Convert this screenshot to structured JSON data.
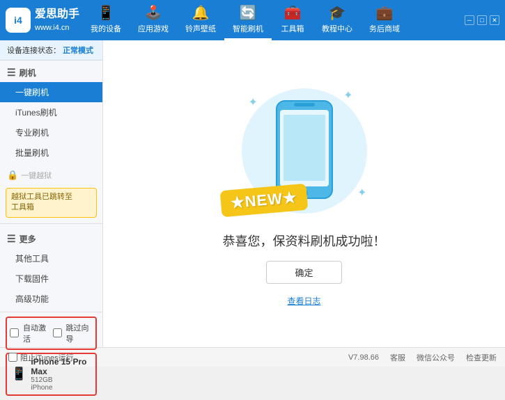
{
  "app": {
    "logo_code": "i4",
    "logo_url": "www.i4.cn",
    "title": "爱思助手"
  },
  "nav": {
    "items": [
      {
        "id": "my-device",
        "label": "我的设备",
        "icon": "📱",
        "active": false
      },
      {
        "id": "apps-games",
        "label": "应用游戏",
        "icon": "👤",
        "active": false
      },
      {
        "id": "ringtone",
        "label": "铃声壁纸",
        "icon": "🔔",
        "active": false
      },
      {
        "id": "smart-flash",
        "label": "智能刷机",
        "icon": "🔄",
        "active": true
      },
      {
        "id": "toolbox",
        "label": "工具箱",
        "icon": "🧰",
        "active": false
      },
      {
        "id": "tutorials",
        "label": "教程中心",
        "icon": "🎓",
        "active": false
      },
      {
        "id": "service",
        "label": "务后商域",
        "icon": "💼",
        "active": false
      }
    ]
  },
  "sidebar": {
    "status_label": "设备连接状态：",
    "status_value": "正常模式",
    "section_flash": "刷机",
    "items": [
      {
        "id": "one-key-flash",
        "label": "一键刷机",
        "active": true
      },
      {
        "id": "itunes-flash",
        "label": "iTunes刷机",
        "active": false
      },
      {
        "id": "pro-flash",
        "label": "专业刷机",
        "active": false
      },
      {
        "id": "batch-flash",
        "label": "批量刷机",
        "active": false
      }
    ],
    "disabled_label": "一键越狱",
    "notice_text": "越狱工具已跳转至\n工具箱",
    "section_more": "更多",
    "more_items": [
      {
        "id": "other-tools",
        "label": "其他工具",
        "active": false
      },
      {
        "id": "download-firmware",
        "label": "下载固件",
        "active": false
      },
      {
        "id": "advanced",
        "label": "高级功能",
        "active": false
      }
    ],
    "auto_activate_label": "自动激活",
    "guide_export_label": "跳过向导",
    "device_name": "iPhone 15 Pro Max",
    "device_storage": "512GB",
    "device_type": "iPhone"
  },
  "content": {
    "success_text": "恭喜您，保资料刷机成功啦！",
    "confirm_button": "确定",
    "log_link": "查看日志"
  },
  "bottombar": {
    "stop_itunes_label": "阻止iTunes运行",
    "version": "V7.98.66",
    "items": [
      "客服",
      "微信公众号",
      "检查更新"
    ]
  },
  "colors": {
    "brand_blue": "#1a7fd4",
    "accent_yellow": "#f5c518",
    "light_blue_bg": "#e0f4fd"
  }
}
